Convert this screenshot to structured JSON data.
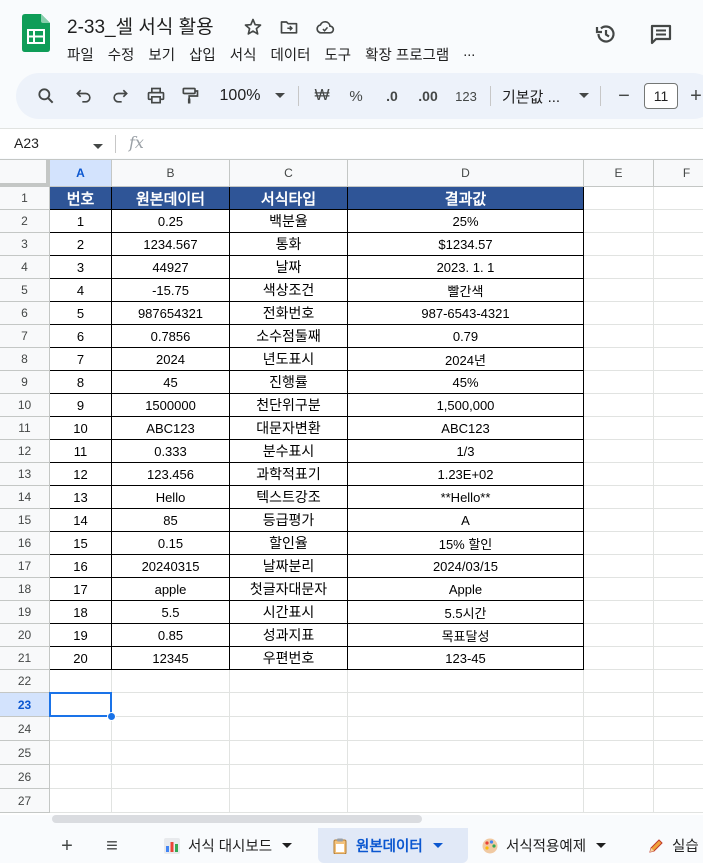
{
  "doc": {
    "title": "2-33_셀 서식 활용",
    "star_icon": "star-icon",
    "move_icon": "move-to-folder-icon",
    "cloud_icon": "cloud-saved-icon"
  },
  "menu": [
    "파일",
    "수정",
    "보기",
    "삽입",
    "서식",
    "데이터",
    "도구",
    "확장 프로그램",
    "..."
  ],
  "header_right": {
    "history_icon": "version-history-icon",
    "comment_icon": "comment-icon"
  },
  "toolbar": {
    "zoom": "100%",
    "currency": "₩",
    "percent": "%",
    "decrease_decimal": ".0",
    "increase_decimal": ".00",
    "number_format": "123",
    "font": "기본값 ...",
    "font_size": "11",
    "minus": "−",
    "plus": "+"
  },
  "formula_bar": {
    "cell_ref": "A23",
    "fx": "fx",
    "value": ""
  },
  "columns": [
    "A",
    "B",
    "C",
    "D",
    "E",
    "F"
  ],
  "rows": [
    "1",
    "2",
    "3",
    "4",
    "5",
    "6",
    "7",
    "8",
    "9",
    "10",
    "11",
    "12",
    "13",
    "14",
    "15",
    "16",
    "17",
    "18",
    "19",
    "20",
    "21",
    "22",
    "23",
    "24",
    "25",
    "26",
    "27"
  ],
  "table": {
    "headers": [
      "번호",
      "원본데이터",
      "서식타입",
      "결과값"
    ],
    "rows": [
      [
        "1",
        "0.25",
        "백분율",
        "25%"
      ],
      [
        "2",
        "1234.567",
        "통화",
        "$1234.57"
      ],
      [
        "3",
        "44927",
        "날짜",
        "2023. 1. 1"
      ],
      [
        "4",
        "-15.75",
        "색상조건",
        "빨간색"
      ],
      [
        "5",
        "987654321",
        "전화번호",
        "987-6543-4321"
      ],
      [
        "6",
        "0.7856",
        "소수점둘째",
        "0.79"
      ],
      [
        "7",
        "2024",
        "년도표시",
        "2024년"
      ],
      [
        "8",
        "45",
        "진행률",
        "45%"
      ],
      [
        "9",
        "1500000",
        "천단위구분",
        "1,500,000"
      ],
      [
        "10",
        "ABC123",
        "대문자변환",
        "ABC123"
      ],
      [
        "11",
        "0.333",
        "분수표시",
        "1/3"
      ],
      [
        "12",
        "123.456",
        "과학적표기",
        "1.23E+02"
      ],
      [
        "13",
        "Hello",
        "텍스트강조",
        "**Hello**"
      ],
      [
        "14",
        "85",
        "등급평가",
        "A"
      ],
      [
        "15",
        "0.15",
        "할인율",
        "15% 할인"
      ],
      [
        "16",
        "20240315",
        "날짜분리",
        "2024/03/15"
      ],
      [
        "17",
        "apple",
        "첫글자대문자",
        "Apple"
      ],
      [
        "18",
        "5.5",
        "시간표시",
        "5.5시간"
      ],
      [
        "19",
        "0.85",
        "성과지표",
        "목표달성"
      ],
      [
        "20",
        "12345",
        "우편번호",
        "123-45"
      ]
    ]
  },
  "header_fill_color": "#2f5597",
  "selection_color": "#1a73e8",
  "sheets": [
    {
      "label": "서식 대시보드",
      "icon": "chart-icon",
      "active": false
    },
    {
      "label": "원본데이터",
      "icon": "clipboard-icon",
      "active": true
    },
    {
      "label": "서식적용예제",
      "icon": "palette-icon",
      "active": false
    },
    {
      "label": "실습",
      "icon": "pencil-icon",
      "active": false
    }
  ],
  "tab_controls": {
    "add": "+",
    "all_sheets": "≡"
  }
}
